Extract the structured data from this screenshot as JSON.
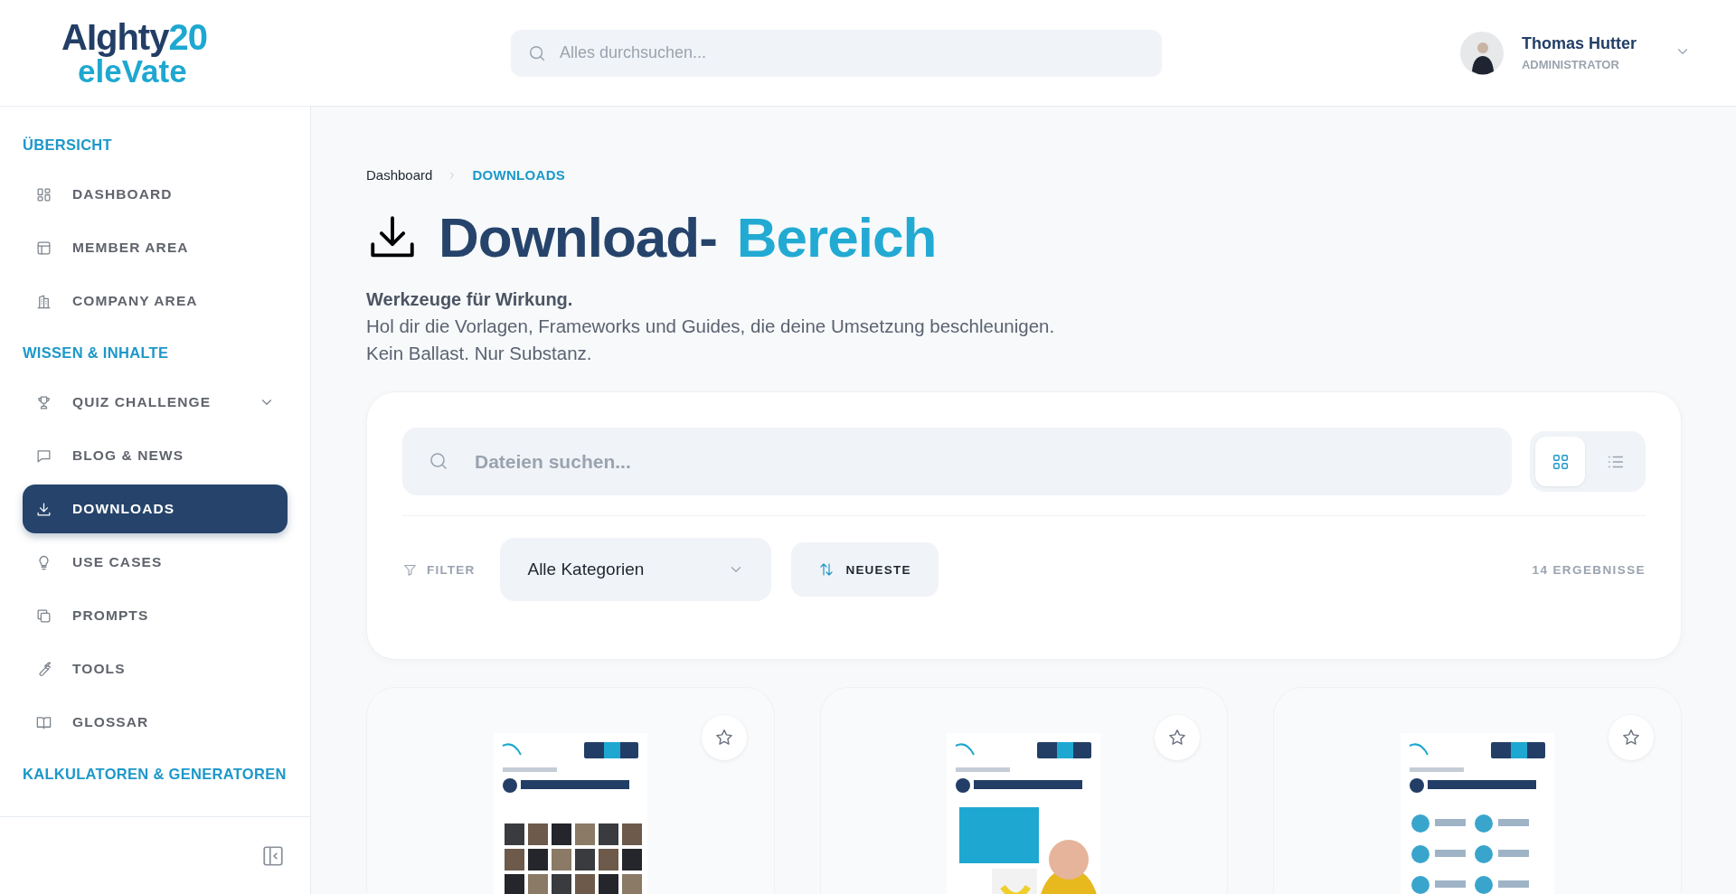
{
  "logo": {
    "name": "AIghty",
    "number": "20",
    "tagline": "eleVate"
  },
  "header": {
    "search": {
      "placeholder": "Alles durchsuchen..."
    },
    "user": {
      "name": "Thomas Hutter",
      "role": "ADMINISTRATOR"
    }
  },
  "sidebar": {
    "sections": [
      {
        "title": "ÜBERSICHT",
        "items": [
          {
            "label": "DASHBOARD",
            "kind": "link",
            "selected": false
          },
          {
            "label": "MEMBER AREA",
            "kind": "link",
            "selected": false
          },
          {
            "label": "COMPANY AREA",
            "kind": "link",
            "selected": false
          }
        ]
      },
      {
        "title": "WISSEN & INHALTE",
        "items": [
          {
            "label": "QUIZ CHALLENGE",
            "kind": "group",
            "selected": false
          },
          {
            "label": "BLOG & NEWS",
            "kind": "link",
            "selected": false
          },
          {
            "label": "DOWNLOADS",
            "kind": "link",
            "selected": true
          },
          {
            "label": "USE CASES",
            "kind": "link",
            "selected": false
          },
          {
            "label": "PROMPTS",
            "kind": "link",
            "selected": false
          },
          {
            "label": "TOOLS",
            "kind": "link",
            "selected": false
          },
          {
            "label": "GLOSSAR",
            "kind": "link",
            "selected": false
          }
        ]
      },
      {
        "title": "KALKULATOREN & GENERATOREN"
      }
    ]
  },
  "breadcrumb": [
    {
      "label": "Dashboard",
      "selected": false
    },
    {
      "label": "DOWNLOADS",
      "selected": true
    }
  ],
  "title": {
    "main": "Download-",
    "accent": "Bereich"
  },
  "intro": {
    "headline": "Werkzeuge für Wirkung.",
    "lines": [
      "Hol dir die Vorlagen, Frameworks und Guides, die deine Umsetzung beschleunigen.",
      "Kein Ballast. Nur Substanz."
    ]
  },
  "panel": {
    "search": {
      "placeholder": "Dateien suchen..."
    },
    "view_modes": [
      {
        "kind": "grid",
        "selected": true
      },
      {
        "kind": "list",
        "selected": false
      }
    ],
    "filter_label": "FILTER",
    "category": "Alle Kategorien",
    "sort": "NEUESTE",
    "result_count": "14 ERGEBNISSE"
  }
}
